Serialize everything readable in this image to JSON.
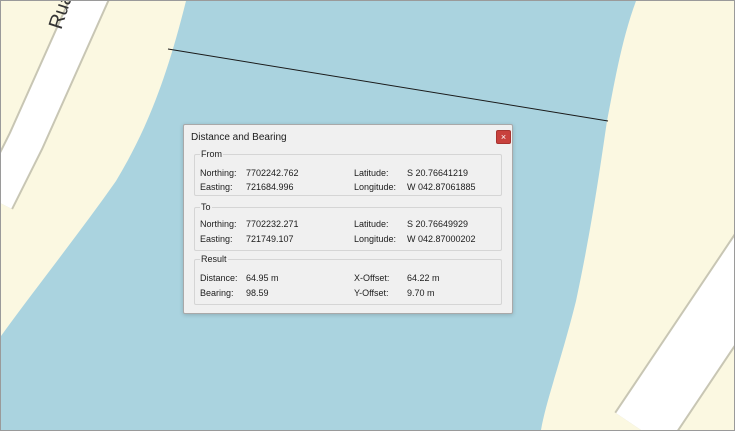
{
  "map": {
    "road_label": "Rua da",
    "colors": {
      "water": "#aad3df",
      "land": "#fbf8e1",
      "road": "#ffffff",
      "road_casing": "#c8c6b4",
      "measure_line": "#1a1a1a"
    }
  },
  "dialog": {
    "title": "Distance and Bearing",
    "close_icon": "×",
    "from": {
      "title": "From",
      "northing_label": "Northing:",
      "northing": "7702242.762",
      "easting_label": "Easting:",
      "easting": "721684.996",
      "latitude_label": "Latitude:",
      "latitude": "S 20.76641219",
      "longitude_label": "Longitude:",
      "longitude": "W 042.87061885"
    },
    "to": {
      "title": "To",
      "northing_label": "Northing:",
      "northing": "7702232.271",
      "easting_label": "Easting:",
      "easting": "721749.107",
      "latitude_label": "Latitude:",
      "latitude": "S 20.76649929",
      "longitude_label": "Longitude:",
      "longitude": "W 042.87000202"
    },
    "result": {
      "title": "Result",
      "distance_label": "Distance:",
      "distance": "64.95 m",
      "bearing_label": "Bearing:",
      "bearing": "98.59",
      "x_offset_label": "X-Offset:",
      "x_offset": "64.22 m",
      "y_offset_label": "Y-Offset:",
      "y_offset": "9.70 m"
    }
  }
}
